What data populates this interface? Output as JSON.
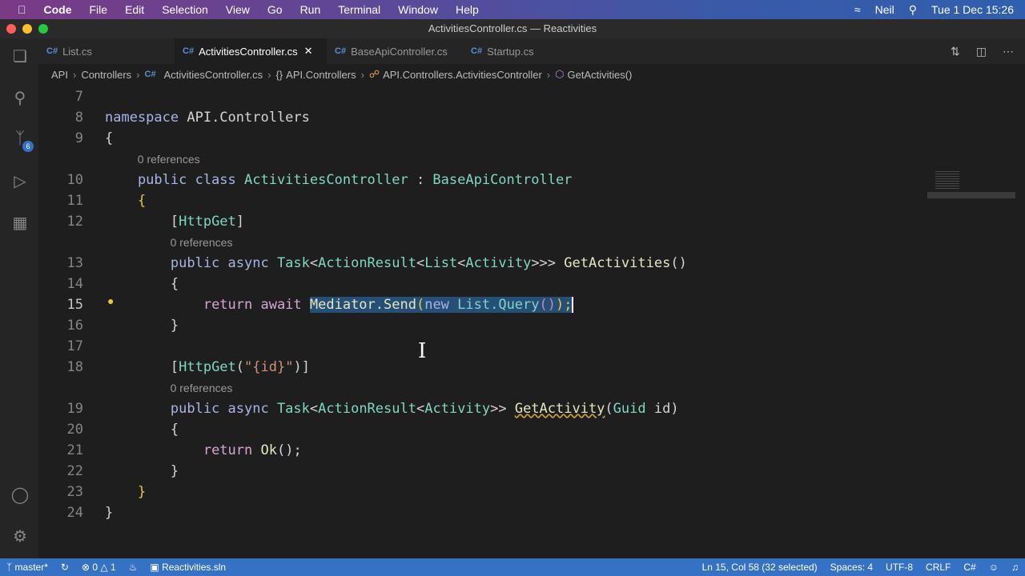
{
  "menubar": {
    "app": "Code",
    "items": [
      "File",
      "Edit",
      "Selection",
      "View",
      "Go",
      "Run",
      "Terminal",
      "Window",
      "Help"
    ],
    "user": "Neil",
    "clock": "Tue 1 Dec  15:26"
  },
  "window": {
    "title": "ActivitiesController.cs — Reactivities"
  },
  "tabs": [
    {
      "label": "List.cs"
    },
    {
      "label": "ActivitiesController.cs",
      "active": true
    },
    {
      "label": "BaseApiController.cs"
    },
    {
      "label": "Startup.cs"
    }
  ],
  "cs_badge": "C#",
  "breadcrumbs": [
    "API",
    "Controllers",
    "ActivitiesController.cs",
    "API.Controllers",
    "API.Controllers.ActivitiesController",
    "GetActivities()"
  ],
  "activity_badge": "6",
  "code": [
    {
      "n": "7",
      "t": []
    },
    {
      "n": "8",
      "t": [
        [
          "namespace ",
          "kw"
        ],
        [
          "API.Controllers",
          "pl"
        ]
      ]
    },
    {
      "n": "9",
      "t": [
        [
          "{",
          "pl"
        ]
      ]
    },
    {
      "lens": "0 references",
      "indent": 4
    },
    {
      "n": "10",
      "t": [
        [
          "    public class ",
          "kw"
        ],
        [
          "ActivitiesController",
          "ty"
        ],
        [
          " : ",
          "pl"
        ],
        [
          "BaseApiController",
          "ty"
        ]
      ]
    },
    {
      "n": "11",
      "t": [
        [
          "    {",
          "yl"
        ]
      ]
    },
    {
      "n": "12",
      "t": [
        [
          "        [",
          "pl"
        ],
        [
          "HttpGet",
          "ty"
        ],
        [
          "]",
          "pl"
        ]
      ]
    },
    {
      "lens": "0 references",
      "indent": 8
    },
    {
      "n": "13",
      "t": [
        [
          "        public async ",
          "kw"
        ],
        [
          "Task",
          "ty"
        ],
        [
          "<",
          "pl"
        ],
        [
          "ActionResult",
          "ty"
        ],
        [
          "<",
          "pl"
        ],
        [
          "List",
          "ty"
        ],
        [
          "<",
          "pl"
        ],
        [
          "Activity",
          "ty"
        ],
        [
          ">>> ",
          "pl"
        ],
        [
          "GetActivities",
          "fn"
        ],
        [
          "()",
          "pl"
        ]
      ]
    },
    {
      "n": "14",
      "t": [
        [
          "        {",
          "pl"
        ]
      ]
    },
    {
      "n": "15",
      "cur": true,
      "t": [
        [
          "            ",
          "pl"
        ],
        [
          "return await ",
          "kw2"
        ],
        [
          "Mediator.Send",
          "fn",
          "sel"
        ],
        [
          "(",
          "yl",
          "sel"
        ],
        [
          "new ",
          "kw",
          "sel"
        ],
        [
          "List.Query",
          "ty",
          "sel"
        ],
        [
          "()",
          "pu",
          "sel"
        ],
        [
          ");",
          "yl",
          "sel"
        ]
      ]
    },
    {
      "n": "16",
      "t": [
        [
          "        }",
          "pl"
        ]
      ]
    },
    {
      "n": "17",
      "t": []
    },
    {
      "n": "18",
      "t": [
        [
          "        [",
          "pl"
        ],
        [
          "HttpGet",
          "ty"
        ],
        [
          "(",
          "pl"
        ],
        [
          "\"{id}\"",
          "st"
        ],
        [
          ")]",
          "pl"
        ]
      ]
    },
    {
      "lens": "0 references",
      "indent": 8
    },
    {
      "n": "19",
      "t": [
        [
          "        public async ",
          "kw"
        ],
        [
          "Task",
          "ty"
        ],
        [
          "<",
          "pl"
        ],
        [
          "ActionResult",
          "ty"
        ],
        [
          "<",
          "pl"
        ],
        [
          "Activity",
          "ty"
        ],
        [
          ">> ",
          "pl"
        ],
        [
          "GetActivity",
          "fn",
          "squig"
        ],
        [
          "(",
          "pl"
        ],
        [
          "Guid ",
          "ty"
        ],
        [
          "id",
          "pl"
        ],
        [
          ")",
          "pl"
        ]
      ]
    },
    {
      "n": "20",
      "t": [
        [
          "        {",
          "pl"
        ]
      ]
    },
    {
      "n": "21",
      "t": [
        [
          "            ",
          "pl"
        ],
        [
          "return ",
          "kw2"
        ],
        [
          "Ok",
          "fn"
        ],
        [
          "();",
          "pl"
        ]
      ]
    },
    {
      "n": "22",
      "t": [
        [
          "        }",
          "pl"
        ]
      ]
    },
    {
      "n": "23",
      "t": [
        [
          "    }",
          "yl"
        ]
      ]
    },
    {
      "n": "24",
      "t": [
        [
          "}",
          "pl"
        ]
      ]
    }
  ],
  "status": {
    "branch": "master*",
    "errors": "0",
    "warnings": "1",
    "solution": "Reactivities.sln",
    "position": "Ln 15, Col 58 (32 selected)",
    "spaces": "Spaces: 4",
    "encoding": "UTF-8",
    "eol": "CRLF",
    "language": "C#"
  }
}
